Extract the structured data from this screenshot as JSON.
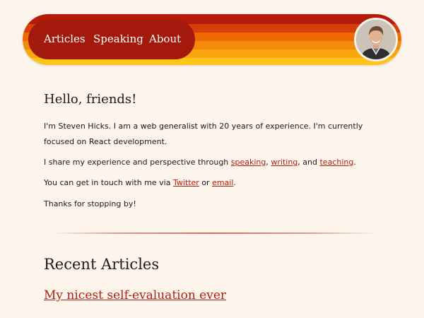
{
  "nav": {
    "items": [
      {
        "label": "Articles"
      },
      {
        "label": "Speaking"
      },
      {
        "label": "About"
      }
    ]
  },
  "intro": {
    "greeting": "Hello, friends!",
    "p1": {
      "t1": "I'm ",
      "name": "Steven Hicks",
      "t2": ". I am a ",
      "role": "web generalist",
      "t3": " with 20 years of experience. I'm currently focused on ",
      "focus": "React",
      "t4": " development."
    },
    "p2": {
      "t1": "I share my experience and perspective through ",
      "link1": "speaking",
      "sep1": ", ",
      "link2": "writing",
      "sep2": ", and ",
      "link3": "teaching",
      "end": "."
    },
    "p3": {
      "t1": "You can get in touch with me via ",
      "link1": "Twitter",
      "sep": " or ",
      "link2": "email",
      "end": "."
    },
    "p4": "Thanks for stopping by!"
  },
  "recent": {
    "title": "Recent Articles",
    "articles": [
      {
        "title": "My nicest self-evaluation ever"
      }
    ]
  },
  "colors": {
    "background": "#fdf5ec",
    "nav_pill": "#a3190c",
    "link": "#b01f10",
    "stripes": [
      "#b51b0a",
      "#d63f07",
      "#ee6a05",
      "#f48a09",
      "#f8a80e",
      "#fbc51a"
    ]
  },
  "icons": {
    "avatar": "profile-photo"
  }
}
